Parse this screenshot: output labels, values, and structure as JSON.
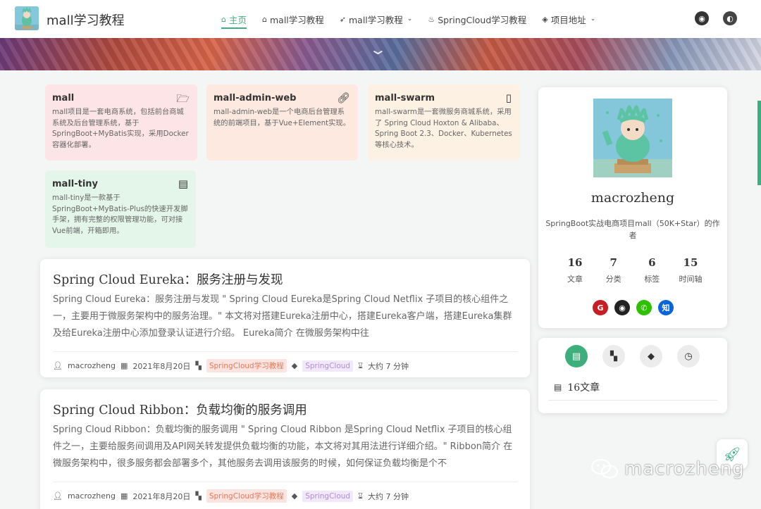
{
  "site": {
    "title": "mall学习教程"
  },
  "nav": {
    "items": [
      {
        "icon": "home-icon",
        "label": "主页",
        "active": true,
        "dropdown": false
      },
      {
        "icon": "home-icon",
        "label": "mall学习教程",
        "active": false,
        "dropdown": false
      },
      {
        "icon": "rocket-icon",
        "label": "mall学习教程",
        "active": false,
        "dropdown": true
      },
      {
        "icon": "fire-icon",
        "label": "SpringCloud学习教程",
        "active": false,
        "dropdown": false
      },
      {
        "icon": "layers-icon",
        "label": "项目地址",
        "active": false,
        "dropdown": true
      }
    ],
    "right_icons": [
      "github-icon",
      "theme-toggle-icon"
    ]
  },
  "projects": [
    {
      "name": "mall",
      "icon": "folder-open-icon",
      "desc": "mall项目是一套电商系统，包括前台商城系统及后台管理系统，基于SpringBoot+MyBatis实现，采用Docker容器化部署。",
      "color": "#fde4e6"
    },
    {
      "name": "mall-admin-web",
      "icon": "link-icon",
      "desc": "mall-admin-web是一个电商后台管理系统的前端项目，基于Vue+Element实现。",
      "color": "#fde9e0"
    },
    {
      "name": "mall-swarm",
      "icon": "bookmark-icon",
      "desc": "mall-swarm是一套微服务商城系统，采用了 Spring Cloud Hoxton & Alibaba、Spring Boot 2.3、Docker、Kubernetes等核心技术。",
      "color": "#fdf1e4"
    },
    {
      "name": "mall-tiny",
      "icon": "document-icon",
      "desc": "mall-tiny是一款基于SpringBoot+MyBatis-Plus的快速开发脚手架，拥有完整的权限管理功能，可对接Vue前端，开箱即用。",
      "color": "#e4f6ea"
    }
  ],
  "articles": [
    {
      "title": "Spring Cloud Eureka：服务注册与发现",
      "excerpt": "Spring Cloud Eureka：服务注册与发现 \" Spring Cloud Eureka是Spring Cloud Netflix 子项目的核心组件之一，主要用于微服务架构中的服务治理。\" 本文将对搭建Eureka注册中心，搭建Eureka客户端，搭建Eureka集群及给Eureka注册中心添加登录认证进行介绍。 Eureka简介 在微服务架构中往",
      "author": "macrozheng",
      "date": "2021年8月20日",
      "category": "SpringCloud学习教程",
      "tag": "SpringCloud",
      "read_time": "大约 7 分钟"
    },
    {
      "title": "Spring Cloud Ribbon：负载均衡的服务调用",
      "excerpt": "Spring Cloud Ribbon：负载均衡的服务调用 \" Spring Cloud Ribbon 是Spring Cloud Netflix 子项目的核心组件之一，主要给服务间调用及API网关转发提供负载均衡的功能，本文将对其用法进行详细介绍。\" Ribbon简介 在微服务架构中，很多服务都会部署多个，其他服务去调用该服务的时候，如何保证负载均衡是个不",
      "author": "macrozheng",
      "date": "2021年8月20日",
      "category": "SpringCloud学习教程",
      "tag": "SpringCloud",
      "read_time": "大约 7 分钟"
    }
  ],
  "profile": {
    "name": "macrozheng",
    "bio": "SpringBoot实战电商项目mall（50K+Star）的作者",
    "stats": [
      {
        "value": "16",
        "label": "文章"
      },
      {
        "value": "7",
        "label": "分类"
      },
      {
        "value": "6",
        "label": "标签"
      },
      {
        "value": "15",
        "label": "时间轴"
      }
    ],
    "socials": [
      {
        "icon": "gitee-icon",
        "glyph": "G",
        "color": "#c71d23"
      },
      {
        "icon": "github-icon",
        "glyph": "◉",
        "color": "#222222"
      },
      {
        "icon": "wechat-icon",
        "glyph": "✆",
        "color": "#2dc100"
      },
      {
        "icon": "zhihu-icon",
        "glyph": "知",
        "color": "#0a66d8"
      }
    ]
  },
  "widget": {
    "tabs": [
      "article-icon",
      "category-icon",
      "tag-icon",
      "clock-icon"
    ],
    "count_label": "16文章"
  },
  "watermark": {
    "text": "macrozheng"
  },
  "theme": {
    "accent": "#3eaf7c"
  }
}
